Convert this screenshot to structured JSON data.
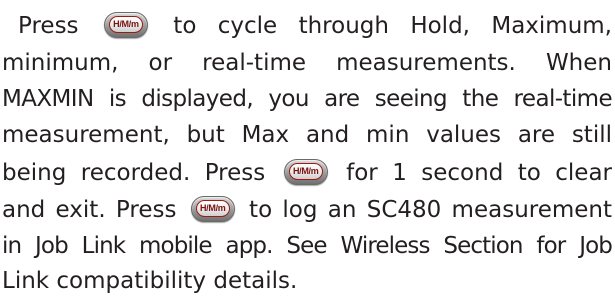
{
  "paragraph": {
    "line1_pre": "Press",
    "line1_post": "to cycle through Hold, Maximum,",
    "line2": "minimum, or real-time measurements. When",
    "line3": "MAXMIN is displayed, you are seeing the real-time",
    "line4": "measurement, but Max and min values are still",
    "line5_pre": "being recorded. Press",
    "line5_post": "for 1 second to clear",
    "line6_pre": "and exit. Press",
    "line6_post": "to log an SC480 measurement",
    "line7": "in Job Link mobile app. See Wireless Section for Job",
    "line8": "Link compatibility details."
  },
  "button": {
    "label": "H/M/m"
  }
}
